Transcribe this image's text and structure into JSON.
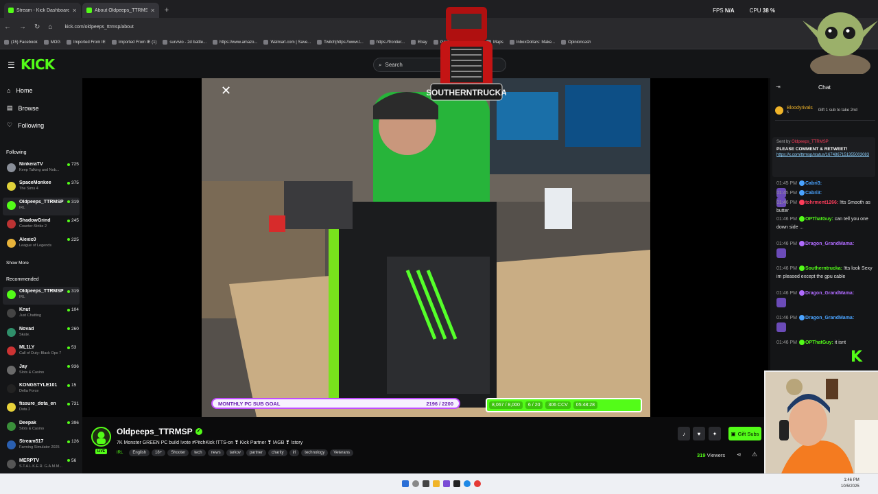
{
  "browser": {
    "tabs": [
      {
        "label": "Stream - Kick Dashboard",
        "active": false
      },
      {
        "label": "About Oldpeeps_TTRMSP",
        "active": true
      }
    ],
    "new_tab": "+",
    "url": "kick.com/oldpeeps_ttrmsp/about",
    "stats": {
      "fps_label": "FPS",
      "fps_value": "N/A",
      "cpu_label": "CPU",
      "cpu_value": "38 %"
    },
    "bookmarks": [
      "(15) Facebook",
      "MOG",
      "Imported From IE",
      "Imported From IE (1)",
      "survivio - 2d battle...",
      "https://www.amazo...",
      "Walmart.com | Save...",
      "Twitch|https://www.t...",
      "https://frontier...",
      "Ebay",
      "Gmail",
      "YouTube",
      "Maps",
      "InboxDollars: Make...",
      "Opinioncash"
    ]
  },
  "kick": {
    "logo": "KICK",
    "search_placeholder": "Search"
  },
  "sidebar": {
    "nav": [
      {
        "label": "Home",
        "icon": "home-icon"
      },
      {
        "label": "Browse",
        "icon": "browse-icon"
      },
      {
        "label": "Following",
        "icon": "heart-icon"
      }
    ],
    "following_header": "Following",
    "following": [
      {
        "name": "NinkeraTV",
        "category": "Keep Talking and Nob...",
        "viewers": "725",
        "color": "#8a8f99"
      },
      {
        "name": "SpaceMonkee",
        "category": "The Sims 4",
        "viewers": "375",
        "color": "#e0d23a"
      },
      {
        "name": "Oldpeeps_TTRMSP",
        "category": "IRL",
        "viewers": "319",
        "color": "#53fc18"
      },
      {
        "name": "ShadowGrind",
        "category": "Counter-Strike 2",
        "viewers": "245",
        "color": "#b33"
      },
      {
        "name": "Alexic0",
        "category": "League of Legends",
        "viewers": "225",
        "color": "#e8b33a"
      }
    ],
    "show_more": "Show More",
    "recommended_header": "Recommended",
    "recommended": [
      {
        "name": "Oldpeeps_TTRMSP",
        "category": "IRL",
        "viewers": "319",
        "color": "#53fc18"
      },
      {
        "name": "Knut",
        "category": "Just Chatting",
        "viewers": "104",
        "color": "#444"
      },
      {
        "name": "Novad",
        "category": "Skate.",
        "viewers": "260",
        "color": "#2f8f6a"
      },
      {
        "name": "ML1LY",
        "category": "Call of Duty: Black Ops 7",
        "viewers": "53",
        "color": "#c33"
      },
      {
        "name": "Jay",
        "category": "Slots & Casino",
        "viewers": "936",
        "color": "#6a6a6a"
      },
      {
        "name": "KONGSTYLE101",
        "category": "Delta Force",
        "viewers": "15",
        "color": "#222"
      },
      {
        "name": "fissure_dota_en",
        "category": "Dota 2",
        "viewers": "731",
        "color": "#e8d23a"
      },
      {
        "name": "Deepak",
        "category": "Slots & Casino",
        "viewers": "396",
        "color": "#3a8f3a"
      },
      {
        "name": "Stream517",
        "category": "Farming Simulator 2025",
        "viewers": "126",
        "color": "#2a5fb0"
      },
      {
        "name": "MERPTV",
        "category": "S.T.A.L.K.E.R. G.A.M.M...",
        "viewers": "56",
        "color": "#555"
      }
    ]
  },
  "player": {
    "overlay_logo_text": "SOUTHERNTRUCKA",
    "goal_label": "MONTHLY PC SUB GOAL",
    "goal_value": "2196 / 2200",
    "goal_progress": 0.998,
    "stats": [
      "8,067 / 8,000",
      "6 / 20",
      "306 CCV",
      "05:48:28"
    ]
  },
  "chat": {
    "title": "Chat",
    "gift_user": "Bloodyrivals",
    "gift_count": "5",
    "gift_text": "Gift 1 sub to take 2nd",
    "pinned_sent_by": "Sent by",
    "pinned_user": "Oldpeeps_TTRMSP",
    "pinned_text": "PLEASE COMMENT & RETWEET!",
    "pinned_link": "https://x.com/ttrmsp/status/1674867151355003083",
    "messages": [
      {
        "time": "01:45 PM",
        "user": "Cabri3:",
        "text": "",
        "color": "#4aa3ff"
      },
      {
        "time": "01:45 PM",
        "user": "Cabri3:",
        "text": "",
        "color": "#4aa3ff"
      },
      {
        "time": "01:46 PM",
        "user": "tohrment1266:",
        "text": "!tts Smooth as butter",
        "color": "#ff3d5a"
      },
      {
        "time": "01:46 PM",
        "user": "OPThatGuy:",
        "text": "can tell you one down side ...",
        "color": "#53fc18"
      },
      {
        "time": "01:46 PM",
        "user": "Dragon_GrandMama:",
        "text": "",
        "color": "#b06bff"
      },
      {
        "time": "01:46 PM",
        "user": "Southerntrucka:",
        "text": "!tts look Sexy im pleased except the gpu cable",
        "color": "#53fc18"
      },
      {
        "time": "01:46 PM",
        "user": "Dragon_GrandMama:",
        "text": "",
        "color": "#b06bff"
      },
      {
        "time": "01:46 PM",
        "user": "Dragon_GrandMama:",
        "text": "",
        "color": "#4aa3ff"
      },
      {
        "time": "01:46 PM",
        "user": "OPThatGuy:",
        "text": "it isnt",
        "color": "#53fc18"
      }
    ]
  },
  "channel": {
    "name": "Oldpeeps_TTRMSP",
    "live": "LIVE",
    "title": "7K Monster GREEN PC build !vote #PitchKick !TTS-on ❣ Kick Partner ❣ !AGB ❣ !story",
    "category": "IRL",
    "tags": [
      "English",
      "18+",
      "Shooter",
      "tech",
      "news",
      "tarkov",
      "partner",
      "charity",
      "irl",
      "technology",
      "Veterans"
    ],
    "gift_subs": "Gift Subs",
    "viewer_count": "319",
    "viewer_label": "Viewers"
  },
  "taskbar": {
    "time": "1:46 PM",
    "date": "10/5/2025"
  },
  "colors": {
    "kick_green": "#53fc18",
    "goal_purple": "#c14dff"
  }
}
